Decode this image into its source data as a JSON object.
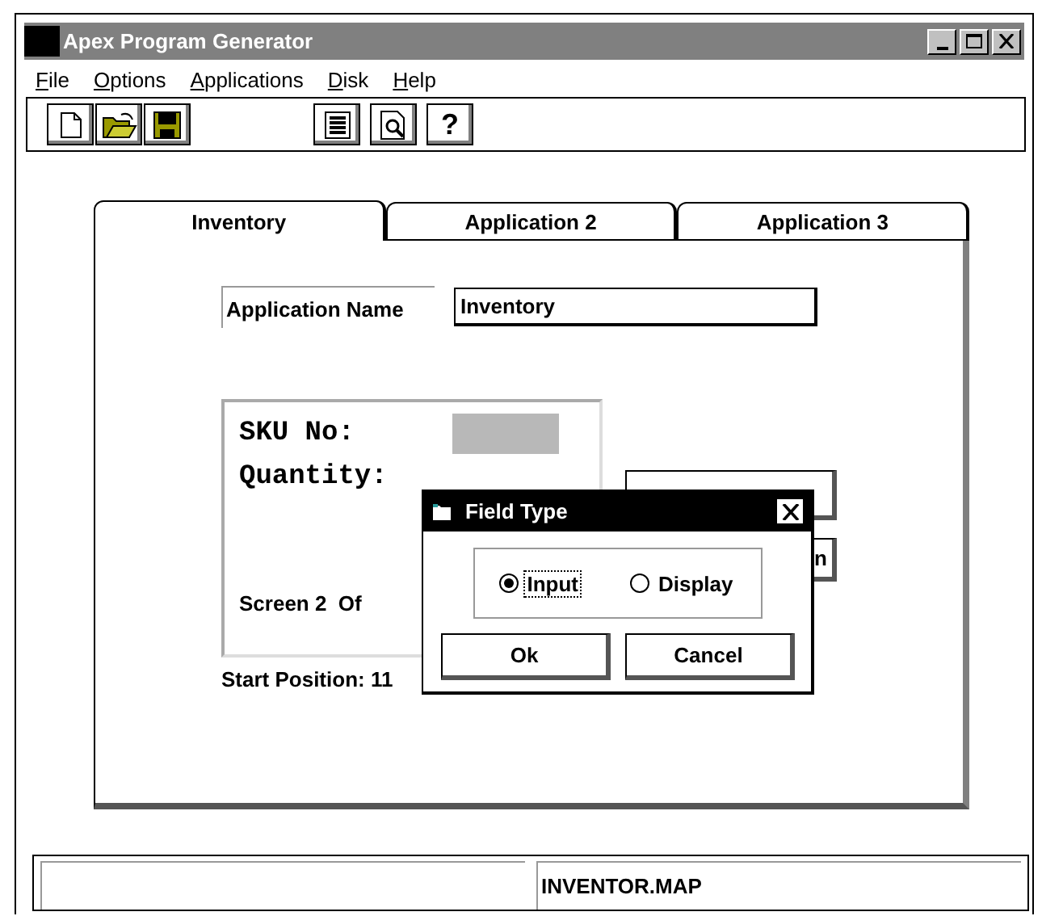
{
  "window": {
    "title": "Apex Program Generator"
  },
  "menu": [
    {
      "label": "File"
    },
    {
      "label": "Options"
    },
    {
      "label": "Applications"
    },
    {
      "label": "Disk"
    },
    {
      "label": "Help"
    }
  ],
  "toolbar": [
    {
      "kind": "new"
    },
    {
      "kind": "open"
    },
    {
      "kind": "save"
    },
    {
      "kind": "list"
    },
    {
      "kind": "preview"
    },
    {
      "kind": "help",
      "label": "?"
    }
  ],
  "tabs": [
    {
      "label": "Inventory",
      "selected": true
    },
    {
      "label": "Application 2",
      "selected": false
    },
    {
      "label": "Application 3",
      "selected": false
    }
  ],
  "app_name": {
    "label": "Application Name",
    "value": "Inventory"
  },
  "preview": {
    "lines": [
      {
        "label": "SKU No:",
        "highlight": true
      },
      {
        "label": "Quantity:",
        "highlight": false
      }
    ],
    "screen_label": "Screen 2  Of"
  },
  "side_buttons": {
    "second_label": "n"
  },
  "start_position": "Start Position: 11",
  "dialog": {
    "title": "Field Type",
    "options": [
      {
        "label": "Input",
        "selected": true,
        "focused": true
      },
      {
        "label": "Display",
        "selected": false,
        "focused": false
      }
    ],
    "buttons": [
      "Ok",
      "Cancel"
    ]
  },
  "status_bar": {
    "right": "INVENTOR.MAP"
  }
}
